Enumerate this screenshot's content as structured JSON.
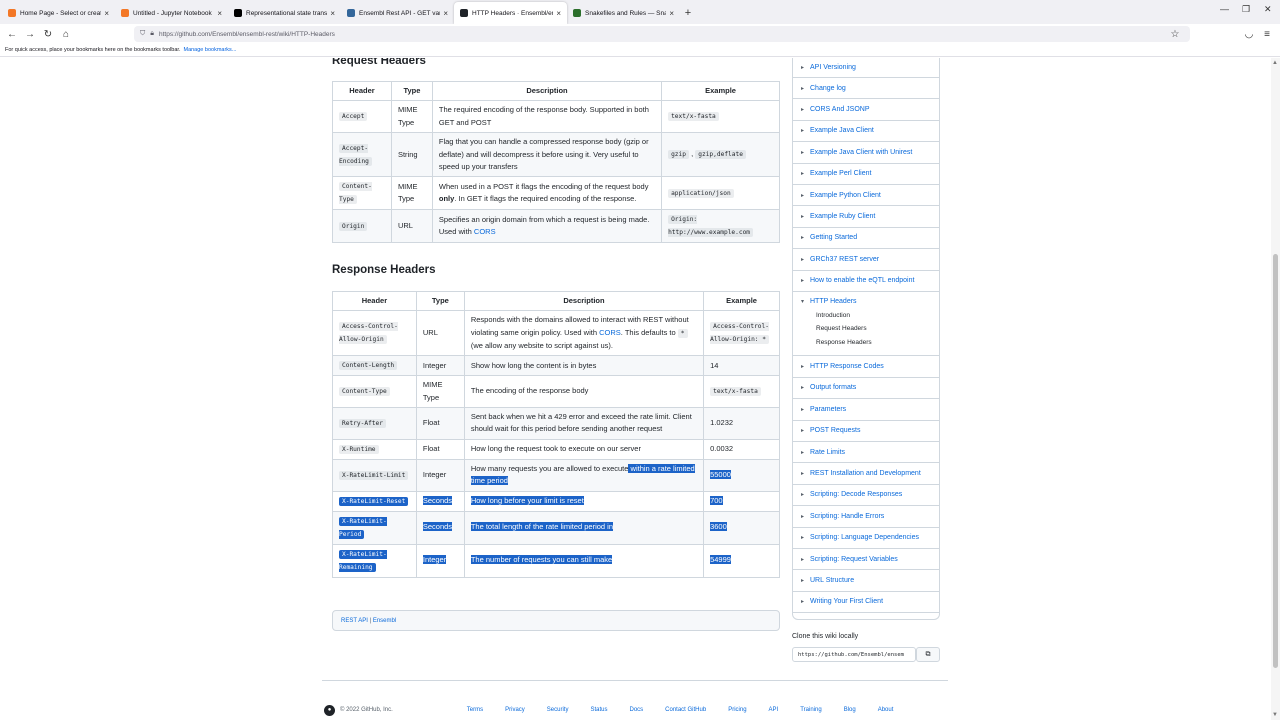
{
  "browser": {
    "tabs": [
      {
        "icon": "jupyter-icon",
        "color": "#f37726",
        "label": "Home Page - Select or create a"
      },
      {
        "icon": "jupyter-icon",
        "color": "#f37726",
        "label": "Untitled - Jupyter Notebook"
      },
      {
        "icon": "wikipedia-icon",
        "color": "#000000",
        "label": "Representational state transfer"
      },
      {
        "icon": "ensembl-icon",
        "color": "#33669a",
        "label": "Ensembl Rest API - GET variatio"
      },
      {
        "icon": "github-icon",
        "color": "#1f2328",
        "label": "HTTP Headers · Ensembl/ensem"
      },
      {
        "icon": "snakemake-icon",
        "color": "#2b6e2b",
        "label": "Snakefiles and Rules — Snakem"
      }
    ],
    "active_tab": 4,
    "url": "https://github.com/Ensembl/ensembl-rest/wiki/HTTP-Headers",
    "bookmarks_text": "For quick access, place your bookmarks here on the bookmarks toolbar.",
    "bookmarks_link": "Manage bookmarks..."
  },
  "request": {
    "heading": "Request Headers",
    "columns": [
      "Header",
      "Type",
      "Description",
      "Example"
    ],
    "rows": [
      {
        "header": "Accept",
        "type": "MIME Type",
        "desc_pre": "The required encoding of the response body. Supported in both GET and POST",
        "example": "text/x-fasta"
      },
      {
        "header": "Accept-Encoding",
        "type": "String",
        "desc_pre": "Flag that you can handle a compressed response body (gzip or deflate) and will decompress it before using it. Very useful to speed up your transfers",
        "example": "gzip",
        "example2": "gzip,deflate"
      },
      {
        "header": "Content-Type",
        "type": "MIME Type",
        "desc_pre": "When used in a POST it flags the encoding of the request body ",
        "desc_bold": "only",
        "desc_post": ". In GET it flags the required encoding of the response.",
        "example": "application/json"
      },
      {
        "header": "Origin",
        "type": "URL",
        "desc_pre": "Specifies an origin domain from which a request is being made. Used with ",
        "desc_link": "CORS",
        "example": "Origin: http://www.example.com"
      }
    ]
  },
  "response": {
    "heading": "Response Headers",
    "columns": [
      "Header",
      "Type",
      "Description",
      "Example"
    ],
    "rows": [
      {
        "header": "Access-Control-Allow-Origin",
        "type": "URL",
        "desc_pre": "Responds with the domains allowed to interact with REST without violating same origin policy. Used with ",
        "desc_link": "CORS",
        "desc_post": ". This defaults to ",
        "desc_code": "*",
        "desc_post2": " (we allow any website to script against us).",
        "example": "Access-Control-Allow-Origin: *"
      },
      {
        "header": "Content-Length",
        "type": "Integer",
        "desc_pre": "Show how long the content is in bytes",
        "example": "14"
      },
      {
        "header": "Content-Type",
        "type": "MIME Type",
        "desc_pre": "The encoding of the response body",
        "example": "text/x-fasta"
      },
      {
        "header": "Retry-After",
        "type": "Float",
        "desc_pre": "Sent back when we hit a 429 error and exceed the rate limit. Client should wait for this period before sending another request",
        "example": "1.0232"
      },
      {
        "header": "X-Runtime",
        "type": "Float",
        "desc_pre": "How long the request took to execute on our server",
        "example": "0.0032"
      },
      {
        "header": "X-RateLimit-Limit",
        "type": "Integer",
        "desc_pre": "How many requests you are allowed to execute",
        "desc_sel": " within a rate limited time period",
        "example": "55000"
      },
      {
        "header": "X-RateLimit-Reset",
        "type": "Seconds",
        "desc_pre": "How long before your limit is reset",
        "example": "700"
      },
      {
        "header": "X-RateLimit-Period",
        "type": "Seconds",
        "desc_pre": "The total length of the rate limited period in",
        "example": "3600"
      },
      {
        "header": "X-RateLimit-Remaining",
        "type": "Integer",
        "desc_pre": "The number of requests you can still make",
        "example": "54999"
      }
    ]
  },
  "wiki_footer": {
    "link1": "REST API",
    "sep": " | ",
    "link2": "Ensembl"
  },
  "sidebar": {
    "items": [
      "API Versioning",
      "Change log",
      "CORS And JSONP",
      "Example Java Client",
      "Example Java Client with Unirest",
      "Example Perl Client",
      "Example Python Client",
      "Example Ruby Client",
      "Getting Started",
      "GRCh37 REST server",
      "How to enable the eQTL endpoint"
    ],
    "open_item": "HTTP Headers",
    "open_subitems": [
      "Introduction",
      "Request Headers",
      "Response Headers"
    ],
    "items_after": [
      "HTTP Response Codes",
      "Output formats",
      "Parameters",
      "POST Requests",
      "Rate Limits",
      "REST Installation and Development",
      "Scripting: Decode Responses",
      "Scripting: Handle Errors",
      "Scripting: Language Dependencies",
      "Scripting: Request Variables",
      "URL Structure",
      "Writing Your First Client"
    ]
  },
  "clone": {
    "title": "Clone this wiki locally",
    "url": "https://github.com/Ensembl/ensem"
  },
  "footer": {
    "copyright": "© 2022 GitHub, Inc.",
    "links": [
      "Terms",
      "Privacy",
      "Security",
      "Status",
      "Docs",
      "Contact GitHub",
      "Pricing",
      "API",
      "Training",
      "Blog",
      "About"
    ]
  },
  "colors": {
    "selection": "#1c63c8",
    "link": "#0969da"
  }
}
